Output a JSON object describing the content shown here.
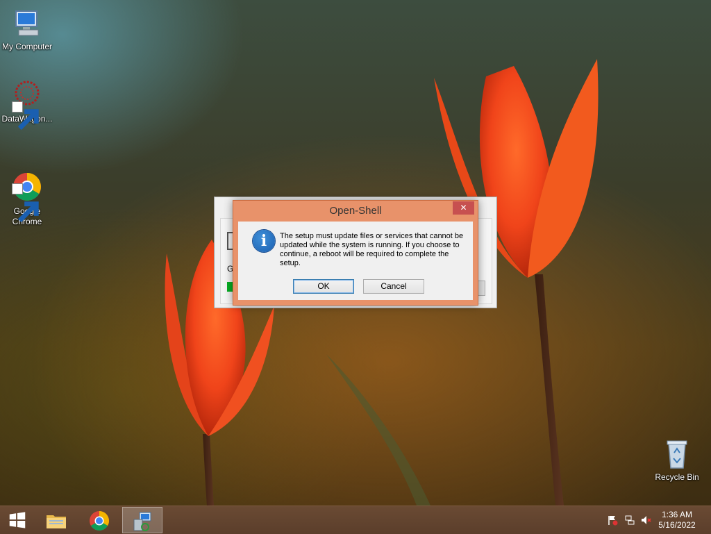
{
  "desktop": {
    "icons": [
      {
        "label": "My Computer"
      },
      {
        "label": "DataWagon..."
      },
      {
        "label": "Google\nChrome"
      },
      {
        "label": "Recycle Bin"
      }
    ]
  },
  "background_window": {
    "label_fragment": "G"
  },
  "dialog": {
    "title": "Open-Shell",
    "close_glyph": "✕",
    "icon": "info-icon",
    "message": "The setup must update files or services that cannot be updated while the system is running. If you choose to continue, a reboot will be required to complete the setup.",
    "ok_label": "OK",
    "cancel_label": "Cancel",
    "accent_color": "#e8926a"
  },
  "taskbar": {
    "items": [
      "start-button",
      "file-explorer",
      "google-chrome",
      "setup-installer"
    ],
    "tray_icons": [
      "flag-icon",
      "network-icon",
      "volume-muted-icon"
    ],
    "time": "1:36 AM",
    "date": "5/16/2022"
  }
}
